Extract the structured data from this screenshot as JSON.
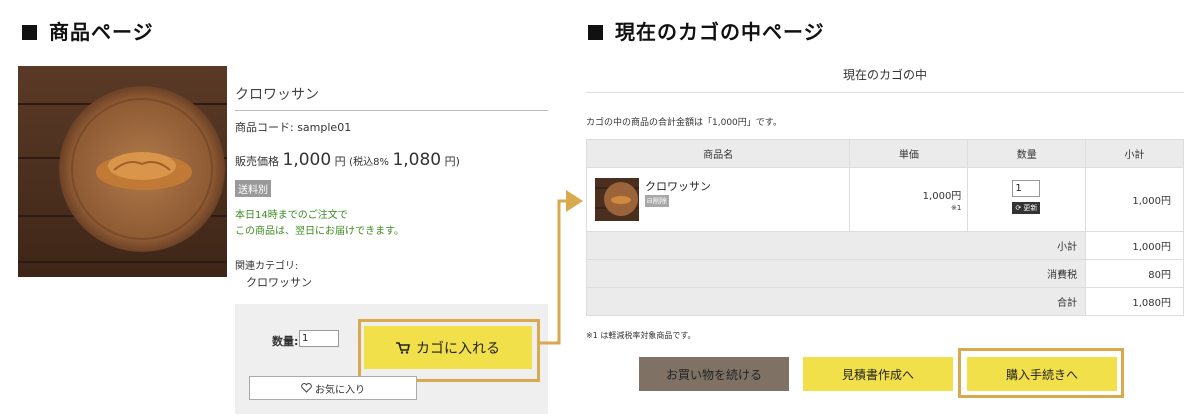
{
  "product_page": {
    "title": "商品ページ",
    "product_name": "クロワッサン",
    "product_code": "商品コード: sample01",
    "price": {
      "label": "販売価格",
      "amount": "1,000",
      "unit": "円",
      "tax_label": "(税込8%",
      "tax_amount": "1,080",
      "tax_unit": "円)"
    },
    "shipping_badge": "送料別",
    "delivery_lines": [
      "本日14時までのご注文で",
      "この商品は、翌日にお届けできます。"
    ],
    "related_label": "関連カテゴリ:",
    "related_category": "クロワッサン",
    "quantity_label": "数量:",
    "quantity_value": "1",
    "cart_button": "カゴに入れる",
    "favorite_button": "お気に入り"
  },
  "cart_page": {
    "title": "現在のカゴの中ページ",
    "header": "現在のカゴの中",
    "total_message": "カゴの中の商品の合計金額は「1,000円」です。",
    "columns": [
      "商品名",
      "単価",
      "数量",
      "小計"
    ],
    "item": {
      "name": "クロワッサン",
      "delete_label": "削除",
      "unit_price": "1,000円",
      "note_mark": "※1",
      "quantity": "1",
      "update_label": "更新",
      "subtotal": "1,000円"
    },
    "summary": [
      {
        "label": "小計",
        "value": "1,000円"
      },
      {
        "label": "消費税",
        "value": "80円"
      },
      {
        "label": "合計",
        "value": "1,080円"
      }
    ],
    "reduced_tax_note": "※1 は軽減税率対象商品です。",
    "buttons": {
      "continue": "お買い物を続ける",
      "estimate": "見積書作成へ",
      "checkout": "購入手続きへ"
    }
  },
  "colors": {
    "accent_yellow": "#f2e04a",
    "highlight_outline": "#d9a94e",
    "continue_button": "#7f7265",
    "delivery_green": "#3d8b1f"
  }
}
